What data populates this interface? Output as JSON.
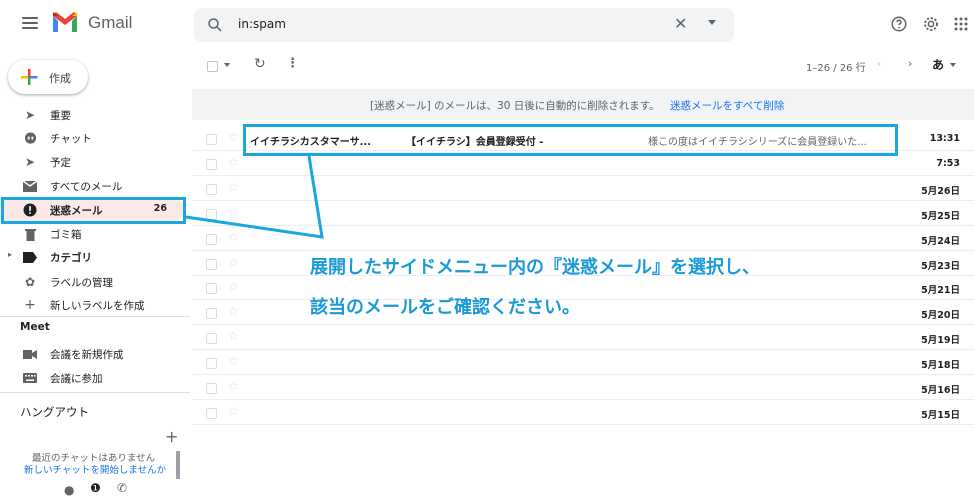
{
  "header": {
    "app_name": "Gmail",
    "search_value": "in:spam",
    "clear_label": "✕"
  },
  "compose": {
    "label": "作成"
  },
  "sidebar": {
    "items": [
      {
        "label": "重要",
        "icon": "important-icon"
      },
      {
        "label": "チャット",
        "icon": "chat-icon"
      },
      {
        "label": "予定",
        "icon": "scheduled-icon"
      },
      {
        "label": "すべてのメール",
        "icon": "mail-icon"
      },
      {
        "label": "迷惑メール",
        "icon": "spam-icon",
        "count": "26",
        "active": true
      },
      {
        "label": "ゴミ箱",
        "icon": "trash-icon"
      },
      {
        "label": "カテゴリ",
        "icon": "label-icon"
      },
      {
        "label": "ラベルの管理",
        "icon": "gear-icon"
      },
      {
        "label": "新しいラベルを作成",
        "icon": "plus-icon"
      }
    ],
    "meet_title": "Meet",
    "meet_items": [
      {
        "label": "会議を新規作成",
        "icon": "video-icon"
      },
      {
        "label": "会議に参加",
        "icon": "keyboard-icon"
      }
    ],
    "hangouts_title": "ハングアウト",
    "no_chat_text": "最近のチャットはありません",
    "start_chat_link": "新しいチャットを開始しませんか"
  },
  "toolbar": {
    "pager_text": "1–26 / 26 行",
    "lang_label": "あ"
  },
  "banner": {
    "text": "[迷惑メール] のメールは、30 日後に自動的に削除されます。",
    "link": "迷惑メールをすべて削除"
  },
  "emails": [
    {
      "sender": "イイチラシカスタマーサ...",
      "subject": "【イイチラシ】会員登録受付 -",
      "snippet": "様この度はイイチラシシリーズに会員登録いた...",
      "date": "13:31"
    },
    {
      "sender": "",
      "subject": "",
      "snippet": "",
      "date": "7:53"
    },
    {
      "sender": "",
      "subject": "",
      "snippet": "",
      "date": "5月26日"
    },
    {
      "sender": "",
      "subject": "",
      "snippet": "",
      "date": "5月25日"
    },
    {
      "sender": "",
      "subject": "",
      "snippet": "",
      "date": "5月24日"
    },
    {
      "sender": "",
      "subject": "",
      "snippet": "",
      "date": "5月23日"
    },
    {
      "sender": "",
      "subject": "",
      "snippet": "",
      "date": "5月21日"
    },
    {
      "sender": "",
      "subject": "",
      "snippet": "",
      "date": "5月20日"
    },
    {
      "sender": "",
      "subject": "",
      "snippet": "",
      "date": "5月19日"
    },
    {
      "sender": "",
      "subject": "",
      "snippet": "",
      "date": "5月18日"
    },
    {
      "sender": "",
      "subject": "",
      "snippet": "",
      "date": "5月16日"
    },
    {
      "sender": "",
      "subject": "",
      "snippet": "",
      "date": "5月15日"
    }
  ],
  "annotation": {
    "line1": "展開したサイドメニュー内の『迷惑メール』を選択し、",
    "line2": "該当のメールをご確認ください。",
    "color": "#1aa6df"
  },
  "colors": {
    "accent": "#1a73e8",
    "spam_active_bg": "#fce8e6"
  }
}
